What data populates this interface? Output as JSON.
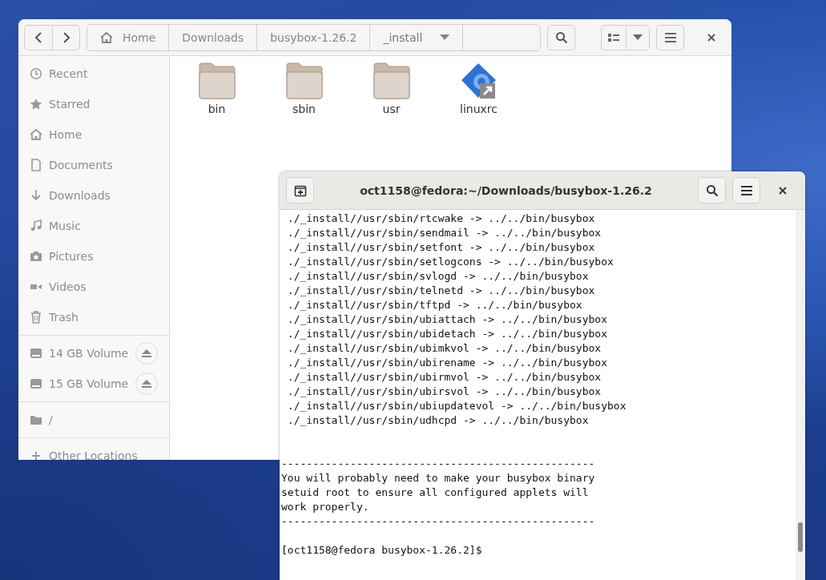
{
  "file_manager": {
    "nav_buttons": [
      {
        "kind": "back"
      },
      {
        "kind": "forward"
      }
    ],
    "path": [
      {
        "label": "Home",
        "kind": "home",
        "selected": false
      },
      {
        "label": "Downloads",
        "kind": "folder",
        "selected": false
      },
      {
        "label": "busybox-1.26.2",
        "kind": "folder",
        "selected": false
      },
      {
        "label": "_install",
        "kind": "folder",
        "selected": true
      }
    ],
    "sidebar": {
      "groups": [
        [
          {
            "label": "Recent",
            "kind": "place"
          },
          {
            "label": "Starred",
            "kind": "place"
          },
          {
            "label": "Home",
            "kind": "place"
          },
          {
            "label": "Documents",
            "kind": "place"
          },
          {
            "label": "Downloads",
            "kind": "place"
          },
          {
            "label": "Music",
            "kind": "place"
          },
          {
            "label": "Pictures",
            "kind": "place"
          },
          {
            "label": "Videos",
            "kind": "place"
          },
          {
            "label": "Trash",
            "kind": "place"
          }
        ],
        [
          {
            "label": "14 GB Volume",
            "kind": "volume"
          },
          {
            "label": "15 GB Volume",
            "kind": "volume"
          }
        ],
        [
          {
            "label": "/",
            "kind": "place"
          }
        ],
        [
          {
            "label": "Other Locations",
            "kind": "place"
          }
        ]
      ]
    },
    "files": [
      {
        "name": "bin",
        "kind": "folder"
      },
      {
        "name": "sbin",
        "kind": "folder"
      },
      {
        "name": "usr",
        "kind": "folder"
      },
      {
        "name": "linuxrc",
        "kind": "link"
      }
    ]
  },
  "terminal": {
    "title": "oct1158@fedora:~/Downloads/busybox-1.26.2",
    "sections": [
      {
        "lines": [
          " ./_install//usr/sbin/rtcwake -> ../../bin/busybox",
          " ./_install//usr/sbin/sendmail -> ../../bin/busybox",
          " ./_install//usr/sbin/setfont -> ../../bin/busybox",
          " ./_install//usr/sbin/setlogcons -> ../../bin/busybox",
          " ./_install//usr/sbin/svlogd -> ../../bin/busybox",
          " ./_install//usr/sbin/telnetd -> ../../bin/busybox",
          " ./_install//usr/sbin/tftpd -> ../../bin/busybox",
          " ./_install//usr/sbin/ubiattach -> ../../bin/busybox",
          " ./_install//usr/sbin/ubidetach -> ../../bin/busybox",
          " ./_install//usr/sbin/ubimkvol -> ../../bin/busybox",
          " ./_install//usr/sbin/ubirename -> ../../bin/busybox",
          " ./_install//usr/sbin/ubirmvol -> ../../bin/busybox",
          " ./_install//usr/sbin/ubirsvol -> ../../bin/busybox",
          " ./_install//usr/sbin/ubiupdatevol -> ../../bin/busybox",
          " ./_install//usr/sbin/udhcpd -> ../../bin/busybox"
        ]
      },
      {
        "lines": [
          "--------------------------------------------------",
          "You will probably need to make your busybox binary",
          "setuid root to ensure all configured applets will",
          "work properly.",
          "--------------------------------------------------"
        ]
      },
      {
        "lines": [
          "[oct1158@fedora busybox-1.26.2]$"
        ]
      }
    ]
  }
}
